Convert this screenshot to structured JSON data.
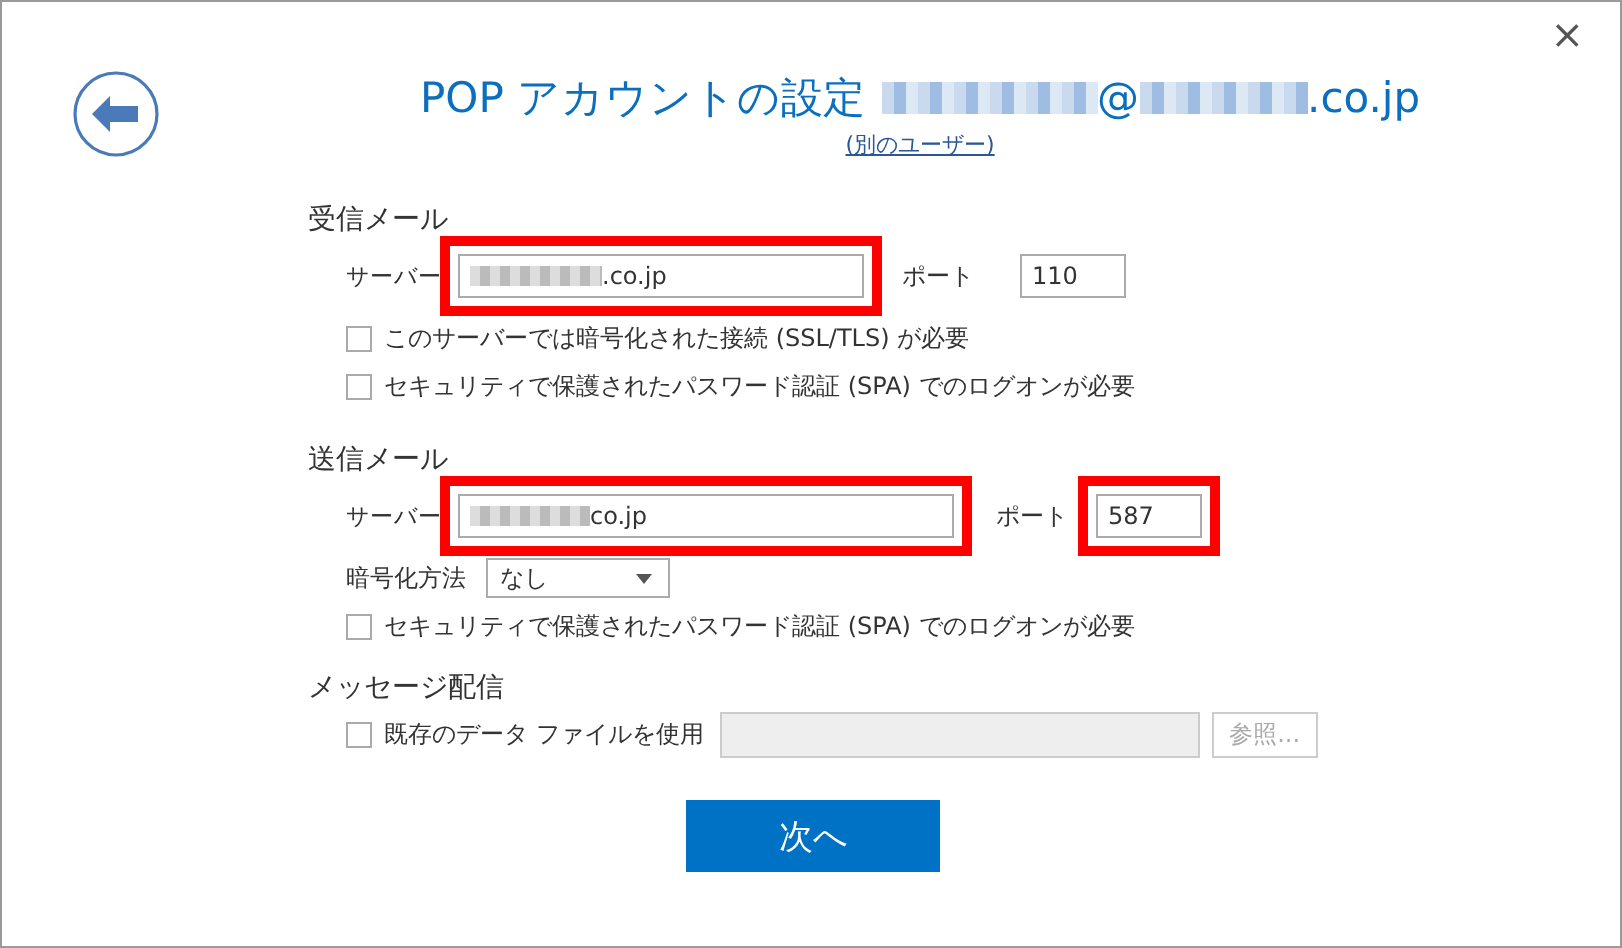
{
  "window": {
    "close": "×"
  },
  "header": {
    "title": "POP アカウントの設定",
    "email_at": "@",
    "email_domain": ".co.jp",
    "switch_user_link": "(別のユーザー)"
  },
  "incoming": {
    "heading": "受信メール",
    "server_label": "サーバー",
    "server_value": ".co.jp",
    "server_highlighted": true,
    "port_label": "ポート",
    "port_value": "110",
    "port_highlighted": false,
    "checkboxes": [
      {
        "label": "このサーバーでは暗号化された接続 (SSL/TLS) が必要",
        "checked": false
      },
      {
        "label": "セキュリティで保護されたパスワード認証 (SPA) でのログオンが必要",
        "checked": false
      }
    ]
  },
  "outgoing": {
    "heading": "送信メール",
    "server_label": "サーバー",
    "server_value": "co.jp",
    "server_highlighted": true,
    "port_label": "ポート",
    "port_value": "587",
    "port_highlighted": true,
    "encryption_label": "暗号化方法",
    "encryption_value": "なし",
    "checkboxes": [
      {
        "label": "セキュリティで保護されたパスワード認証 (SPA) でのログオンが必要",
        "checked": false
      }
    ]
  },
  "delivery": {
    "heading": "メッセージ配信",
    "checkbox": {
      "label": "既存のデータ ファイルを使用",
      "checked": false
    },
    "browse_button": {
      "label": "参照...",
      "disabled": true
    }
  },
  "next_button": "次へ"
}
